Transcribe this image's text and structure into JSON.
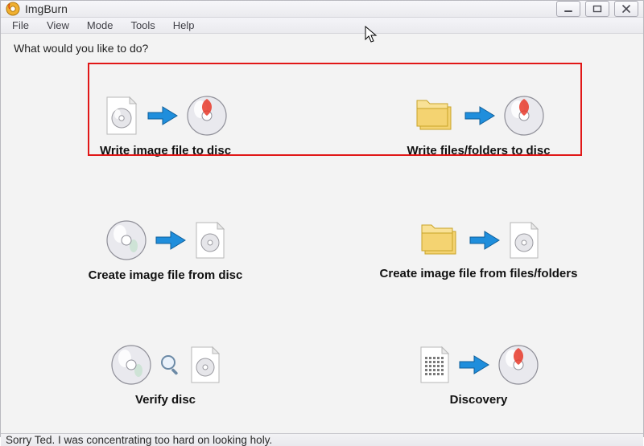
{
  "app": {
    "title": "ImgBurn"
  },
  "menus": {
    "file": "File",
    "view": "View",
    "mode": "Mode",
    "tools": "Tools",
    "help": "Help"
  },
  "prompt": "What would you like to do?",
  "options": {
    "write_image_to_disc": "Write image file to disc",
    "write_files_to_disc": "Write files/folders to disc",
    "create_image_from_disc": "Create image file from disc",
    "create_image_from_files": "Create image file from files/folders",
    "verify_disc": "Verify disc",
    "discovery": "Discovery"
  },
  "statusbar": "Sorry Ted. I was concentrating too hard on looking holy.",
  "colors": {
    "highlight": "#e11717",
    "arrow": "#1f8edc"
  }
}
